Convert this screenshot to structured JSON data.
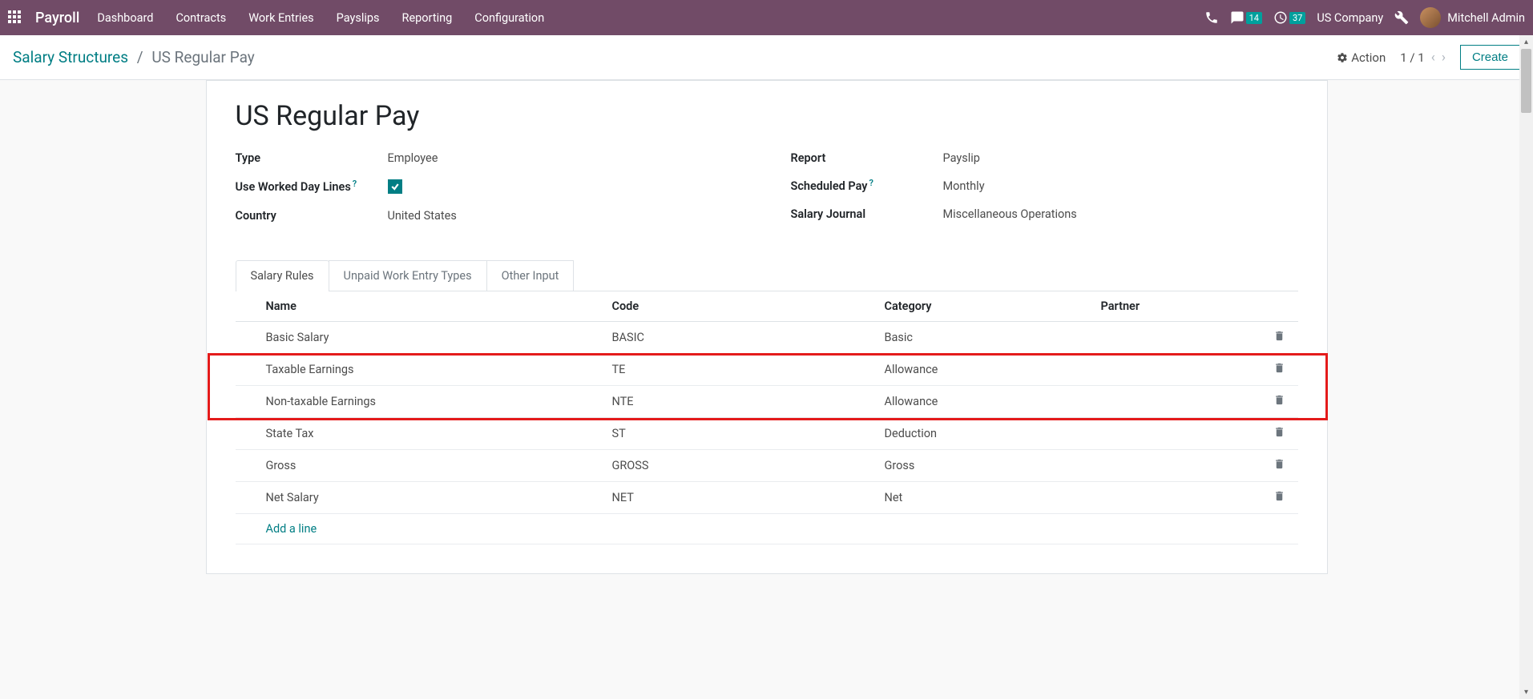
{
  "navbar": {
    "brand": "Payroll",
    "menu": [
      "Dashboard",
      "Contracts",
      "Work Entries",
      "Payslips",
      "Reporting",
      "Configuration"
    ],
    "chat_badge": "14",
    "activity_badge": "37",
    "company": "US Company",
    "user": "Mitchell Admin"
  },
  "breadcrumb": {
    "root": "Salary Structures",
    "current": "US Regular Pay"
  },
  "action_label": "Action",
  "pager": "1 / 1",
  "create_label": "Create",
  "form": {
    "title": "US Regular Pay",
    "left": {
      "type_label": "Type",
      "type_value": "Employee",
      "worked_day_label": "Use Worked Day Lines",
      "country_label": "Country",
      "country_value": "United States"
    },
    "right": {
      "report_label": "Report",
      "report_value": "Payslip",
      "scheduled_label": "Scheduled Pay",
      "scheduled_value": "Monthly",
      "journal_label": "Salary Journal",
      "journal_value": "Miscellaneous Operations"
    }
  },
  "tabs": [
    "Salary Rules",
    "Unpaid Work Entry Types",
    "Other Input"
  ],
  "table": {
    "headers": [
      "Name",
      "Code",
      "Category",
      "Partner"
    ],
    "rows": [
      {
        "name": "Basic Salary",
        "code": "BASIC",
        "category": "Basic",
        "partner": ""
      },
      {
        "name": "Taxable Earnings",
        "code": "TE",
        "category": "Allowance",
        "partner": ""
      },
      {
        "name": "Non-taxable Earnings",
        "code": "NTE",
        "category": "Allowance",
        "partner": ""
      },
      {
        "name": "State Tax",
        "code": "ST",
        "category": "Deduction",
        "partner": ""
      },
      {
        "name": "Gross",
        "code": "GROSS",
        "category": "Gross",
        "partner": ""
      },
      {
        "name": "Net Salary",
        "code": "NET",
        "category": "Net",
        "partner": ""
      }
    ],
    "add_line": "Add a line",
    "highlighted_rows": [
      1,
      2
    ]
  }
}
